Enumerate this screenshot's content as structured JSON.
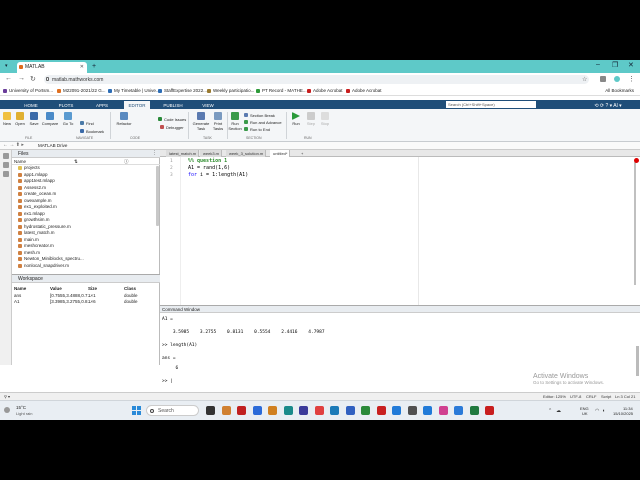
{
  "browser": {
    "tab_title": "MATLAB",
    "url": "matlab.mathworks.com",
    "bookmarks": [
      {
        "label": "University of Portsm...",
        "color": "#6a3d9a"
      },
      {
        "label": "M22091-2021/22 G...",
        "color": "#e07020"
      },
      {
        "label": "My Timetable | Unive...",
        "color": "#2d6db5"
      },
      {
        "label": "StaffExpertise 2022...",
        "color": "#2d6db5"
      },
      {
        "label": "Weekly participatio...",
        "color": "#9a7a30"
      },
      {
        "label": "PT Record - MATHE...",
        "color": "#2e9a3a"
      },
      {
        "label": "Adobe Acrobat",
        "color": "#c81e1e"
      },
      {
        "label": "Adobe Acrobat",
        "color": "#c81e1e"
      }
    ],
    "all_bookmarks": "All Bookmarks"
  },
  "matlab": {
    "tabs": [
      "HOME",
      "PLOTS",
      "APPS",
      "EDITOR",
      "PUBLISH",
      "VIEW"
    ],
    "active_tab": "EDITOR",
    "search_placeholder": "Search (Ctrl+Shift+Space)",
    "ribbon": {
      "file": [
        "New",
        "Open",
        "Save",
        "Compare"
      ],
      "nav": [
        "Go To"
      ],
      "find": "Find",
      "bookmark": "Bookmark",
      "refactor": "Refactor",
      "code_issues": "Code Issues",
      "debugger": "Debugger",
      "generate": "Generate Task",
      "print": "Print Tasks",
      "run_section": "Run Section",
      "section_break": "Section Break",
      "run_advance": "Run and Advance",
      "run_to_end": "Run to End",
      "run": "Run",
      "step": "Step",
      "stop": "Stop",
      "groups": [
        "FILE",
        "NAVIGATE",
        "CODE",
        "TASK",
        "SECTION",
        "RUN"
      ]
    },
    "path": "MATLAB Drive",
    "files_header": "Files",
    "files_col_name": "Name",
    "files": [
      {
        "name": "projects",
        "folder": true
      },
      {
        "name": "app1.mlapp"
      },
      {
        "name": "app1test.mlapp"
      },
      {
        "name": "Assess2.m"
      },
      {
        "name": "create_ocean.m"
      },
      {
        "name": "cwexample.m"
      },
      {
        "name": "ex1_exploited.m"
      },
      {
        "name": "ex1.mlapp"
      },
      {
        "name": "growthsim.m"
      },
      {
        "name": "hydrostatic_pressure.m"
      },
      {
        "name": "latest_match.m"
      },
      {
        "name": "main.m"
      },
      {
        "name": "meshcreator.m"
      },
      {
        "name": "mesh.m"
      },
      {
        "name": "Newton_Miniblocks_spectru..."
      },
      {
        "name": "nonlocal_snapdriver.m"
      }
    ],
    "workspace": {
      "header": "Workspace",
      "cols": [
        "Name",
        "Value",
        "Size",
        "Class"
      ],
      "rows": [
        {
          "name": "ans",
          "value": "[0.7555,3.4888,0.7...",
          "size": "1×1",
          "class": "double"
        },
        {
          "name": "A1",
          "value": "[3.3985,3.2755,0.8...",
          "size": "1×6",
          "class": "double"
        }
      ]
    },
    "editor": {
      "tabs": [
        "latest_match.m",
        "week3.m",
        "week_3_solution.m",
        "untitled*"
      ],
      "active_tab_index": 3,
      "lines": [
        {
          "num": "1",
          "text": "%% question 1",
          "comment": true
        },
        {
          "num": "2",
          "text": "A1 = rand(1,6)",
          "comment": false
        },
        {
          "num": "3",
          "kw": "for",
          "text": " i = 1:length(A1)",
          "comment": false
        }
      ]
    },
    "command_window": {
      "header": "Command Window",
      "lines": [
        "A1 =",
        "",
        "    3.5985    3.2755    0.8131    0.5554    2.4416    4.7987",
        "",
        ">> length(A1)",
        "",
        "ans =",
        "",
        "     6",
        "",
        ">> |"
      ]
    },
    "status": {
      "editor": "Editor: 125%",
      "encoding": "UTF-8",
      "eol": "CRLF",
      "type": "Script",
      "pos": "Ln 3  Col 21"
    },
    "watermark_title": "Activate Windows",
    "watermark_sub": "Go to Settings to activate Windows."
  },
  "taskbar": {
    "weather_temp": "15°C",
    "weather_desc": "Light rain",
    "search_label": "Search",
    "lang": "ENG",
    "region": "UK",
    "time": "11:34",
    "date": "15/10/2025",
    "icons": [
      "#333",
      "#d08030",
      "#c02020",
      "#2a6ad8",
      "#d08020",
      "#1a8a8a",
      "#3a3a9a",
      "#e04040",
      "#1a7ab8",
      "#3060c0",
      "#2a8a3a",
      "#c82020",
      "#207ad8",
      "#505050",
      "#207ad8",
      "#d04090",
      "#2a7ad8",
      "#207a40",
      "#c81e1e"
    ]
  }
}
